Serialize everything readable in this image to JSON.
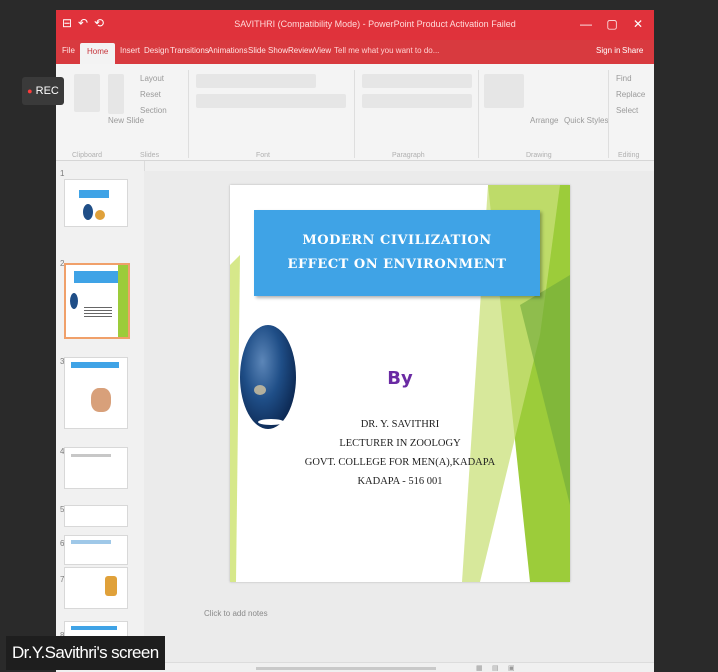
{
  "window": {
    "title": "SAVITHRI (Compatibility Mode) - PowerPoint Product Activation Failed",
    "quick_access": [
      "⊟",
      "↶",
      "⟲"
    ],
    "controls": [
      "—",
      "▢",
      "✕"
    ]
  },
  "tabs": [
    "File",
    "Home",
    "Insert",
    "Design",
    "Transitions",
    "Animations",
    "Slide Show",
    "Review",
    "View"
  ],
  "tell_me": "Tell me what you want to do...",
  "account": {
    "signin": "Sign in",
    "share": "Share"
  },
  "ribbon": {
    "clipboard_labels": [
      "Layout",
      "Reset",
      "Section"
    ],
    "new_slide": "New Slide",
    "arrange": "Arrange",
    "quick_styles": "Quick Styles",
    "editing_items": [
      "Find",
      "Replace",
      "Select"
    ],
    "groups": [
      "Clipboard",
      "Slides",
      "Font",
      "Paragraph",
      "Drawing",
      "Editing"
    ]
  },
  "slides_pane": {
    "numbers": [
      "1",
      "2",
      "3",
      "4",
      "5",
      "6",
      "7",
      "8"
    ]
  },
  "slide": {
    "title": "MODERN CIVILIZATION EFFECT ON ENVIRONMENT",
    "by": "By",
    "author_lines": [
      "DR. Y. SAVITHRI",
      "LECTURER IN ZOOLOGY",
      "GOVT. COLLEGE FOR MEN(A),KADAPA",
      "KADAPA - 516 001"
    ],
    "colors": {
      "title_bg": "#3fa3e6",
      "by": "#6a2aa3",
      "accent_green": "#9ccc3a"
    }
  },
  "notes_placeholder": "Click to add notes",
  "recording": {
    "label": "REC",
    "indicator_color": "#ff3b3b"
  },
  "screen_label": "Dr.Y.Savithri's screen"
}
